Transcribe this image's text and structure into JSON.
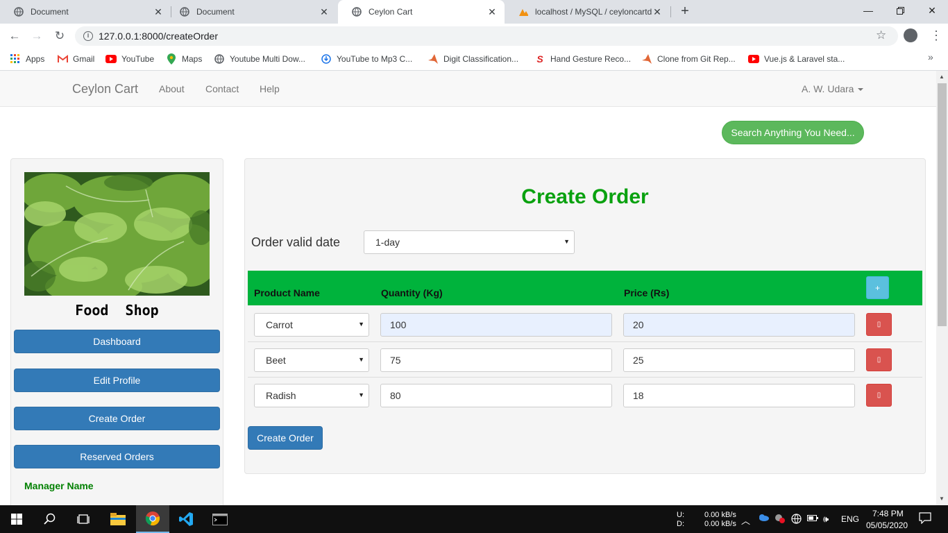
{
  "browser": {
    "tabs": [
      {
        "title": "Document"
      },
      {
        "title": "Document"
      },
      {
        "title": "Ceylon Cart"
      },
      {
        "title": "localhost / MySQL / ceyloncartdb"
      }
    ],
    "url": "127.0.0.1:8000/createOrder",
    "bookmarks": [
      {
        "label": "Apps",
        "icon": "apps-grid-icon"
      },
      {
        "label": "Gmail",
        "icon": "gmail-icon"
      },
      {
        "label": "YouTube",
        "icon": "youtube-icon"
      },
      {
        "label": "Maps",
        "icon": "maps-pin-icon"
      },
      {
        "label": "Youtube Multi Dow...",
        "icon": "globe-icon"
      },
      {
        "label": "YouTube to Mp3 C...",
        "icon": "download-icon"
      },
      {
        "label": "Digit Classification...",
        "icon": "matlab-icon"
      },
      {
        "label": "Hand Gesture Reco...",
        "icon": "s-logo-icon"
      },
      {
        "label": "Clone from Git Rep...",
        "icon": "matlab-icon"
      },
      {
        "label": "Vue.js & Laravel sta...",
        "icon": "youtube-icon"
      }
    ]
  },
  "navbar": {
    "brand": "Ceylon Cart",
    "links": [
      "About",
      "Contact",
      "Help"
    ],
    "user": "A. W. Udara"
  },
  "search_button": "Search Anything You Need...",
  "sidebar": {
    "shop_name": "Food  Shop",
    "buttons": [
      "Dashboard",
      "Edit Profile",
      "Create Order",
      "Reserved Orders"
    ],
    "manager_label": "Manager Name"
  },
  "order_form": {
    "title": "Create Order",
    "valid_date_label": "Order valid date",
    "valid_date_value": "1-day",
    "columns": [
      "Product Name",
      "Quantity (Kg)",
      "Price (Rs)"
    ],
    "add_button": "+",
    "rows": [
      {
        "product": "Carrot",
        "quantity": "100",
        "price": "20"
      },
      {
        "product": "Beet",
        "quantity": "75",
        "price": "25"
      },
      {
        "product": "Radish",
        "quantity": "80",
        "price": "18"
      }
    ],
    "submit_label": "Create Order"
  },
  "taskbar": {
    "net_up_label": "U:",
    "net_down_label": "D:",
    "net_up": "0.00 kB/s",
    "net_down": "0.00 kB/s",
    "language": "ENG",
    "time": "7:48 PM",
    "date": "05/05/2020"
  }
}
